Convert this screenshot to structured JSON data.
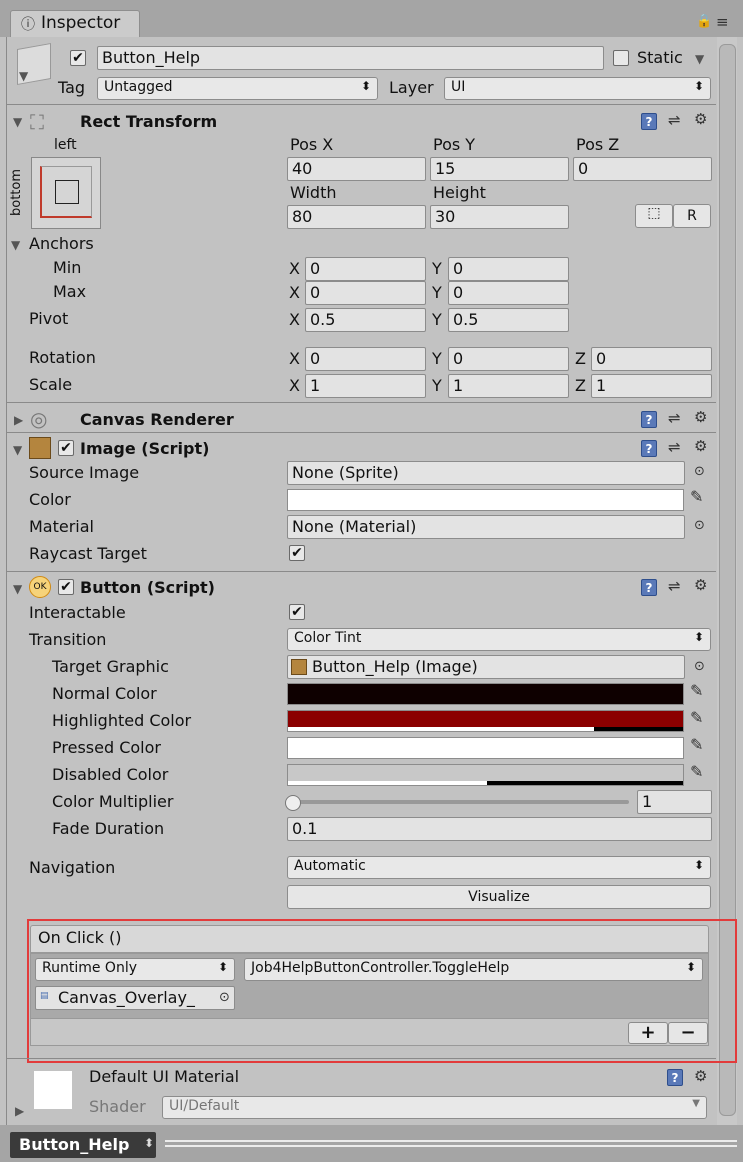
{
  "tab": {
    "title": "Inspector"
  },
  "header": {
    "name": "Button_Help",
    "static_label": "Static",
    "tag_label": "Tag",
    "tag_value": "Untagged",
    "layer_label": "Layer",
    "layer_value": "UI"
  },
  "rect_transform": {
    "title": "Rect Transform",
    "anchor_preset_top": "left",
    "anchor_preset_side": "bottom",
    "pos_x_label": "Pos X",
    "pos_y_label": "Pos Y",
    "pos_z_label": "Pos Z",
    "pos_x": "40",
    "pos_y": "15",
    "pos_z": "0",
    "width_label": "Width",
    "height_label": "Height",
    "width": "80",
    "height": "30",
    "raw_edit_label": "R",
    "anchors_label": "Anchors",
    "min_label": "Min",
    "max_label": "Max",
    "min_x": "0",
    "min_y": "0",
    "max_x": "0",
    "max_y": "0",
    "pivot_label": "Pivot",
    "pivot_x": "0.5",
    "pivot_y": "0.5",
    "rotation_label": "Rotation",
    "rot_x": "0",
    "rot_y": "0",
    "rot_z": "0",
    "scale_label": "Scale",
    "scale_x": "1",
    "scale_y": "1",
    "scale_z": "1",
    "axis_x": "X",
    "axis_y": "Y",
    "axis_z": "Z"
  },
  "canvas_renderer": {
    "title": "Canvas Renderer"
  },
  "image": {
    "title": "Image (Script)",
    "source_image_label": "Source Image",
    "source_image": "None (Sprite)",
    "color_label": "Color",
    "color": "#ffffff",
    "material_label": "Material",
    "material": "None (Material)",
    "raycast_label": "Raycast Target"
  },
  "button": {
    "title": "Button (Script)",
    "icon_text": "OK",
    "interactable_label": "Interactable",
    "transition_label": "Transition",
    "transition": "Color Tint",
    "target_graphic_label": "Target Graphic",
    "target_graphic": "Button_Help (Image)",
    "normal_color_label": "Normal Color",
    "normal_color": "#0e0000",
    "highlighted_color_label": "Highlighted Color",
    "highlighted_color": "#8b0000",
    "pressed_color_label": "Pressed Color",
    "pressed_color": "#ffffff",
    "disabled_color_label": "Disabled Color",
    "disabled_color": "#c8c8c8",
    "color_multiplier_label": "Color Multiplier",
    "color_multiplier": "1",
    "fade_duration_label": "Fade Duration",
    "fade_duration": "0.1",
    "navigation_label": "Navigation",
    "navigation": "Automatic",
    "visualize_label": "Visualize"
  },
  "on_click": {
    "title": "On Click ()",
    "runtime": "Runtime Only",
    "function": "Job4HelpButtonController.ToggleHelp",
    "object": "Canvas_Overlay_",
    "add": "+",
    "remove": "−"
  },
  "material": {
    "title": "Default UI Material",
    "shader_label": "Shader",
    "shader": "UI/Default"
  },
  "footer": {
    "name": "Button_Help"
  }
}
